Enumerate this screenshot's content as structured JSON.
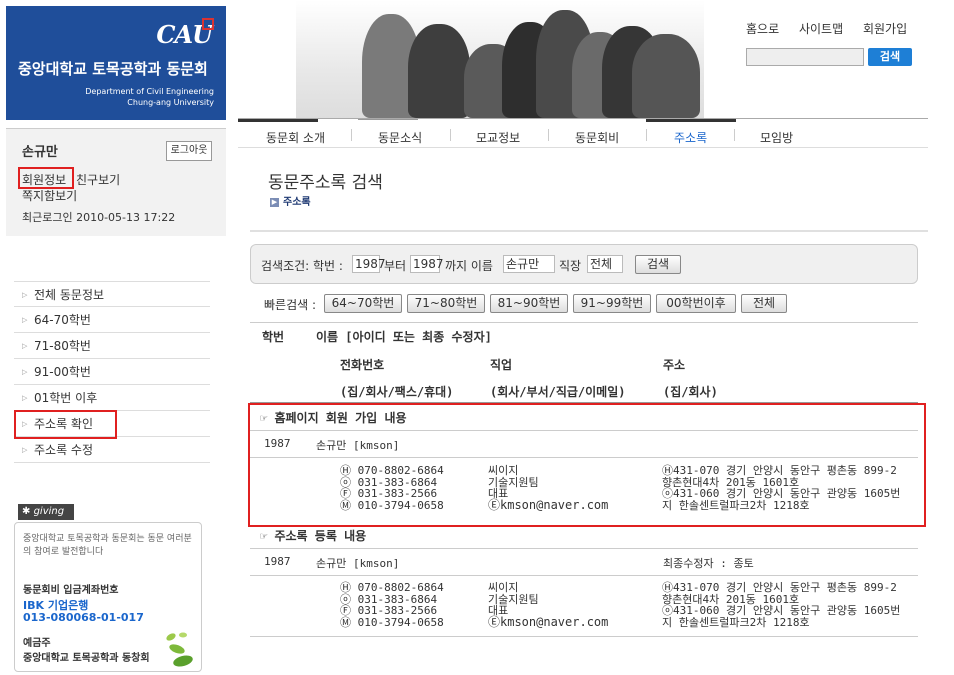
{
  "logo": {
    "mark": "CAU",
    "title": "중앙대학교 토목공학과 동문회",
    "en_line1": "Department of Civil Engineering",
    "en_line2": "Chung-ang University"
  },
  "login": {
    "name": "손규만",
    "logout": "로그아웃",
    "member_info": "회원정보",
    "friends": "친구보기",
    "notes": "쪽지함보기",
    "last_login": "최근로그인 2010-05-13 17:22"
  },
  "sidemenu": [
    "전체 동문정보",
    "64-70학번",
    "71-80학번",
    "91-00학번",
    "01학번 이후",
    "주소록 확인",
    "주소록 수정"
  ],
  "giving": {
    "tag": "giving",
    "desc": "중앙대학교 토목공학과 동문회는 동문 여러분의 참여로 발전합니다",
    "account_label": "동문회비 입금계좌번호",
    "bank": "IBK 기업은행",
    "account": "013-080068-01-017",
    "holder_label": "예금주",
    "holder": "중앙대학교 토목공학과 동창회"
  },
  "toplinks": [
    "홈으로",
    "사이트맵",
    "회원가입"
  ],
  "search": {
    "button": "검색"
  },
  "nav": [
    "동문회 소개",
    "동문소식",
    "모교정보",
    "동문회비",
    "주소록",
    "모임방"
  ],
  "page": {
    "title": "동문주소록 검색",
    "crumb": "주소록"
  },
  "cond": {
    "label": "검색조건: 학번 :",
    "from": "1987",
    "to_label": "부터",
    "to": "1987",
    "until_label": "까지 이름",
    "name": "손규만",
    "job_label": "직장",
    "job": "전체",
    "button": "검색"
  },
  "quick": {
    "label": "빠른검색 :",
    "buttons": [
      "64~70학번",
      "71~80학번",
      "81~90학번",
      "91~99학번",
      "00학번이후",
      "전체"
    ]
  },
  "header": {
    "col1": "학번",
    "col2": "이름 [아이디 또는 최종 수정자]",
    "phone": "전화번호",
    "job": "직업",
    "addr": "주소",
    "phone_sub": "(집/회사/팩스/휴대)",
    "job_sub": "(회사/부서/직급/이메일)",
    "addr_sub": "(집/회사)"
  },
  "section1": {
    "title": "☞ 홈페이지 회원 가입 내용",
    "year": "1987",
    "name": "손규만 [kmson]",
    "phones": [
      "Ⓗ 070-8802-6864",
      "ⓞ 031-383-6864",
      "Ⓕ 031-383-2566",
      "Ⓜ 010-3794-0658"
    ],
    "jobs": [
      "씨이지",
      "기술지원팀",
      "대표",
      "Ⓔkmson@naver.com"
    ],
    "addrs": [
      "Ⓗ431-070 경기 안양시 동안구 평촌동 899-2",
      "향촌현대4차 201동 1601호",
      "ⓞ431-060 경기 안양시 동안구 관양동 1605번",
      "지 한솔센트럴파크2차 1218호"
    ]
  },
  "section2": {
    "title": "☞ 주소록 등록 내용",
    "year": "1987",
    "name": "손규만 [kmson]",
    "modifier": "최종수정자 : 종토",
    "phones": [
      "Ⓗ 070-8802-6864",
      "ⓞ 031-383-6864",
      "Ⓕ 031-383-2566",
      "Ⓜ 010-3794-0658"
    ],
    "jobs": [
      "씨이지",
      "기술지원팀",
      "대표",
      "Ⓔkmson@naver.com"
    ],
    "addrs": [
      "Ⓗ431-070 경기 안양시 동안구 평촌동 899-2",
      "향촌현대4차 201동 1601호",
      "ⓞ431-060 경기 안양시 동안구 관양동 1605번",
      "지 한솔센트럴파크2차 1218호"
    ]
  },
  "colors": {
    "brand": "#1f4e9a",
    "accent": "#1e7fd6",
    "highlight": "#e02020"
  }
}
